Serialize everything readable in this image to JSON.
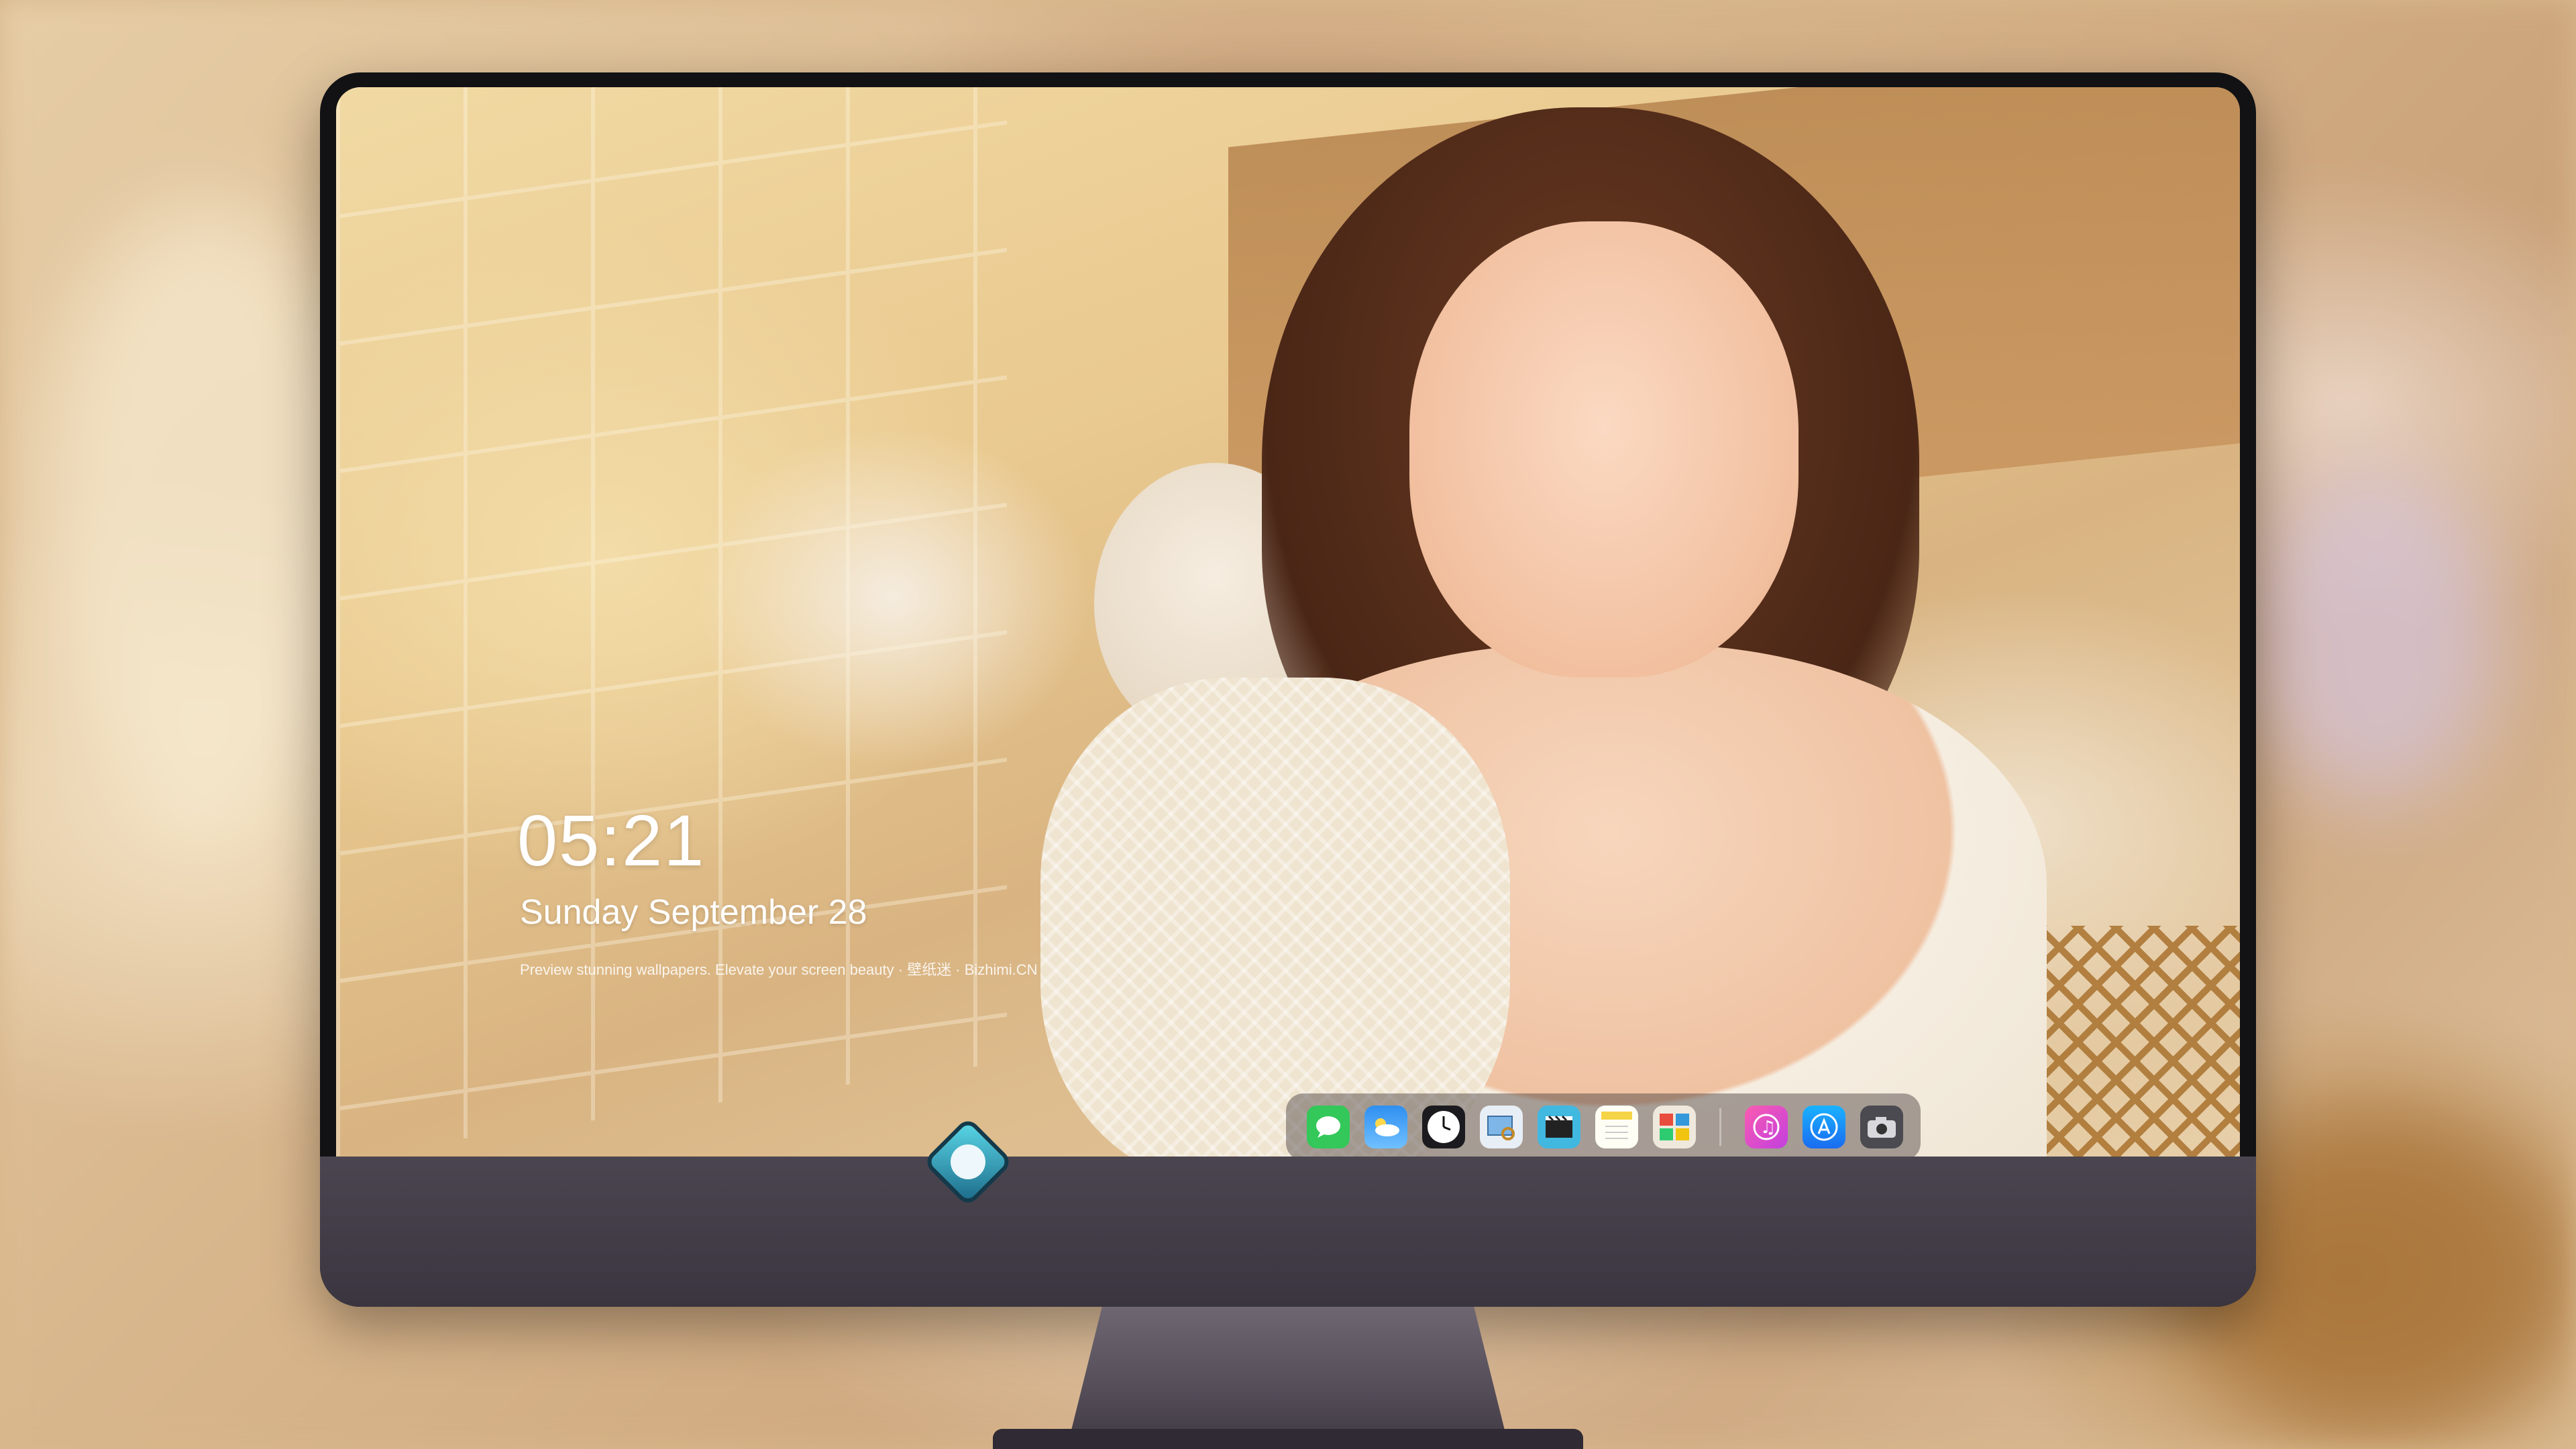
{
  "lockscreen": {
    "time": "05:21",
    "date": "Sunday September 28",
    "tagline": "Preview stunning wallpapers. Elevate your screen beauty · 壁纸迷 · Bizhimi.CN"
  },
  "dock": {
    "apps": [
      {
        "name": "messages-icon",
        "glyph": "💬",
        "color": "#34c759"
      },
      {
        "name": "weather-icon",
        "glyph": "☁",
        "color": "#2f8ff0"
      },
      {
        "name": "clock-icon",
        "glyph": "◷",
        "color": "#ffffff"
      },
      {
        "name": "preview-icon",
        "glyph": "▣",
        "color": "#7fb6e8"
      },
      {
        "name": "clips-icon",
        "glyph": "▤",
        "color": "#40b8e0"
      },
      {
        "name": "notes-icon",
        "glyph": "▬",
        "color": "#f5d547"
      },
      {
        "name": "photo-booth-icon",
        "glyph": "▦",
        "color": "#e9e3d8"
      },
      {
        "name": "music-icon",
        "glyph": "♫",
        "color": "#f04aa5"
      },
      {
        "name": "app-store-icon",
        "glyph": "A",
        "color": "#1a8cff"
      },
      {
        "name": "camera-icon",
        "glyph": "◉",
        "color": "#5d5d63"
      }
    ]
  },
  "monitor": {
    "logo": "dragon-mascot-logo"
  }
}
